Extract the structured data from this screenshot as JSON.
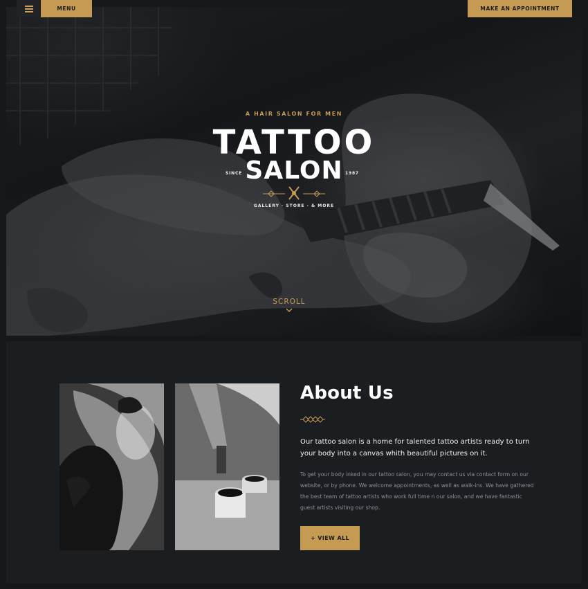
{
  "header": {
    "menu_label": "MENU",
    "menu_icon": "hamburger-icon",
    "appointment_label": "MAKE AN APPOINTMENT"
  },
  "hero": {
    "tagline": "A HAIR SALON FOR MEN",
    "logo_line1": "TATTOO",
    "logo_line2": "SALON",
    "since": "SINCE",
    "year": "1987",
    "links": "GALLERY · STORE · & MORE",
    "scroll_label": "SCROLL",
    "scroll_icon": "chevron-down-icon"
  },
  "about": {
    "title": "About Us",
    "lead": "Our tattoo salon is a home for talented tattoo artists ready to turn your body into a canvas whith beautiful pictures on it.",
    "body": "To get your body inked in our tattoo salon, you may contact us via contact form on our website, or by phone. We welcome appointments, as well as walk-ins. We have gathered the best team of tattoo artists who work full time n our salon, and we have fantastic guest artists visiting our shop.",
    "button_label": "+ VIEW ALL"
  },
  "colors": {
    "accent": "#c59a52",
    "background": "#1b1e21",
    "text": "#ffffff"
  }
}
